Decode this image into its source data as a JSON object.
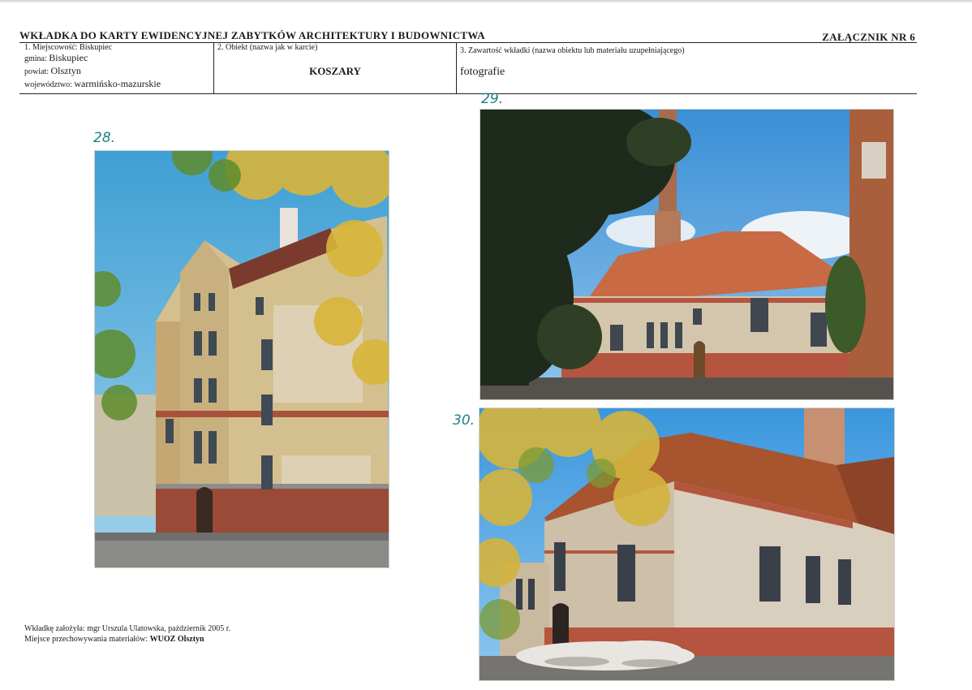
{
  "header": {
    "title": "WKŁADKA DO KARTY EWIDENCYJNEJ ZABYTKÓW ARCHITEKTURY I BUDOWNICTWA",
    "annex": "ZAŁĄCZNIK NR 6"
  },
  "location": {
    "miejscowosc_label": "1. Miejscowość: Biskupiec",
    "gmina_label": "gmina:",
    "gmina_value": "Biskupiec",
    "powiat_label": "powiat:",
    "powiat_value": "Olsztyn",
    "wojewodztwo_label": "województwo:",
    "wojewodztwo_value": "warmińsko-mazurskie"
  },
  "object": {
    "label": "2. Obiekt (nazwa jak w karcie)",
    "value": "KOSZARY"
  },
  "content": {
    "label": "3. Zawartość wkładki (nazwa obiektu lub materiału uzupełniającego)",
    "value": "fotografie"
  },
  "photos": [
    {
      "number": "28.",
      "subject": "three-storey brick barracks building, corner view"
    },
    {
      "number": "29.",
      "subject": "barracks building with chimney and tall tree"
    },
    {
      "number": "30.",
      "subject": "barracks building with rubble pile in front"
    }
  ],
  "footer": {
    "author_label": "Wkładkę założyła:",
    "author_value": "mgr Urszula Ulatowska, październik 2005 r.",
    "storage_label": "Miejsce przechowywania materiałów:",
    "storage_value": "WUOZ Olsztyn"
  },
  "colors": {
    "sky": "#5fb2dc",
    "brick": "#b8553e",
    "plaster": "#d9c9a9",
    "foliage": "#d8b53a",
    "ink_number": "#1f7f86"
  }
}
